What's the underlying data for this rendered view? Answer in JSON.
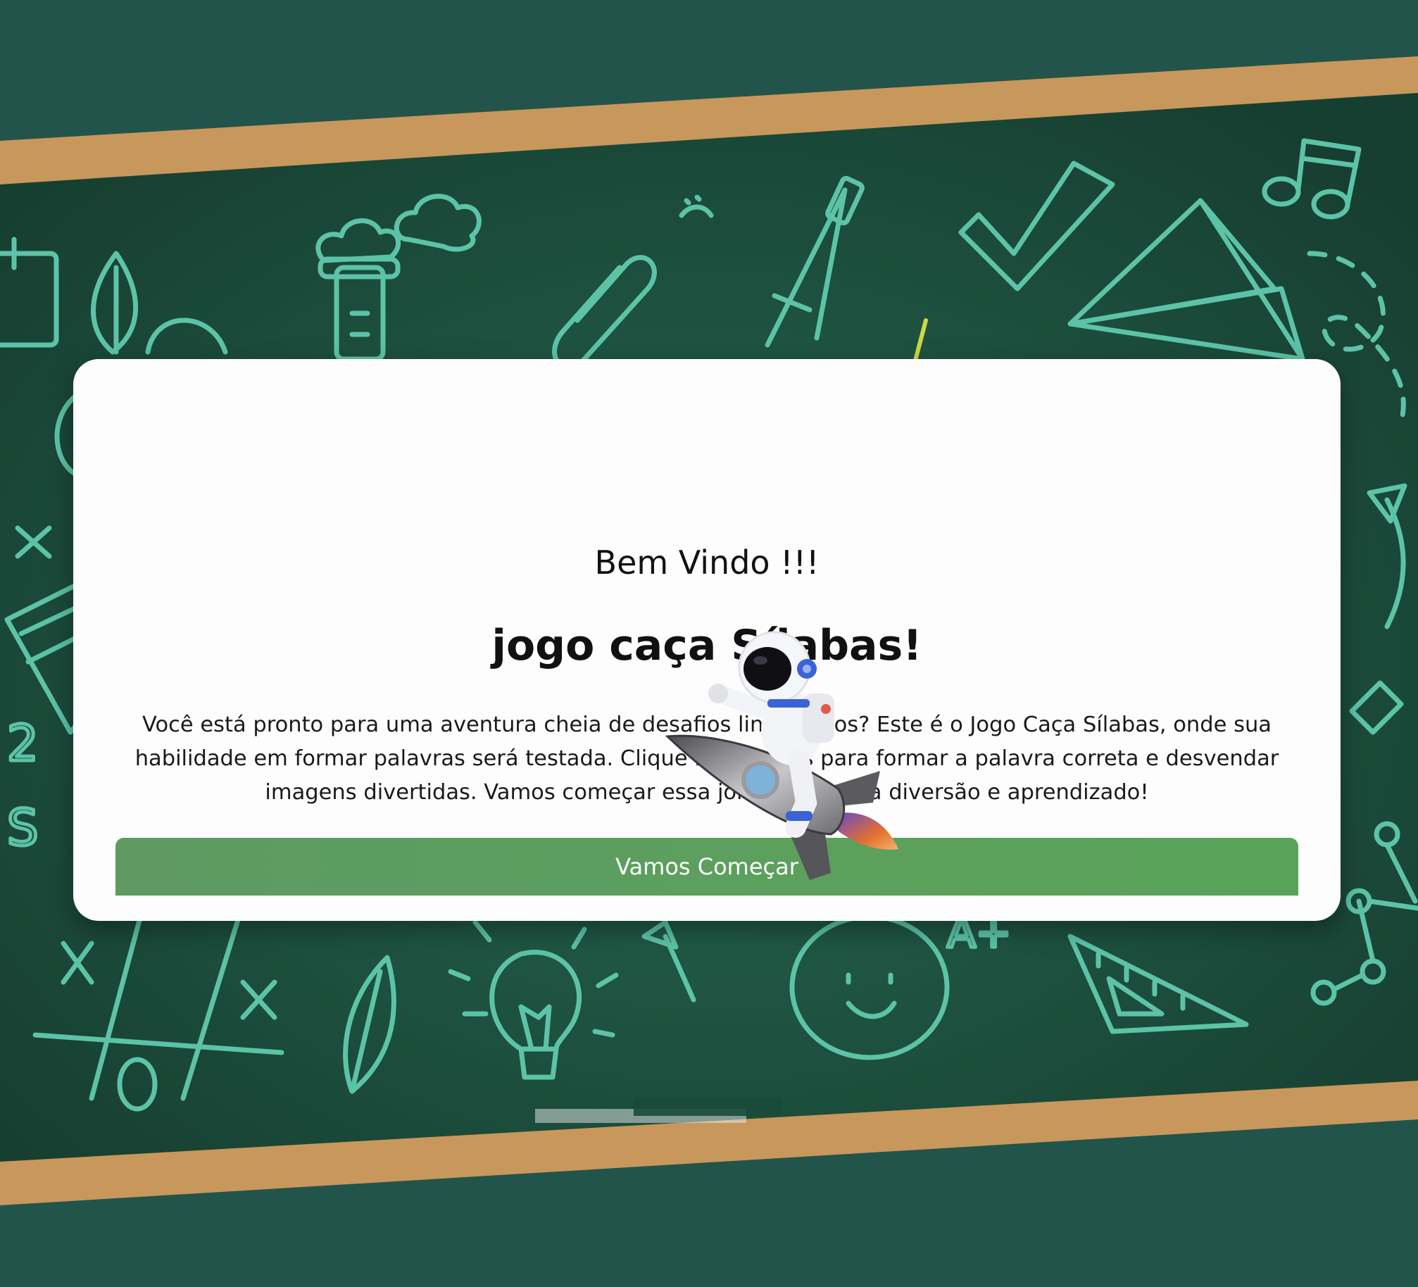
{
  "modal": {
    "greeting": "Bem Vindo !!!",
    "title": "jogo caça Sílabas!",
    "description": "Você está pronto para uma aventura cheia de desafios linguísticos? Este é o Jogo Caça Sílabas, onde sua habilidade em formar palavras será testada. Clique nas sílabas para formar a palavra correta e desvendar imagens divertidas. Vamos começar essa jornada rumo à diversão e aprendizado!",
    "start_button": "Vamos Começar",
    "mascot_icon": "astronaut-on-rocket-icon"
  },
  "background": {
    "board_color": "#1b4a3a",
    "frame_color": "#c8975b",
    "wall_color": "#22544b",
    "doodle_color": "#5cc3a7",
    "theme": "chalkboard-with-school-doodles"
  },
  "colors": {
    "button": "#5a9e5c",
    "card": "#fdfdfd",
    "text": "#111111"
  }
}
